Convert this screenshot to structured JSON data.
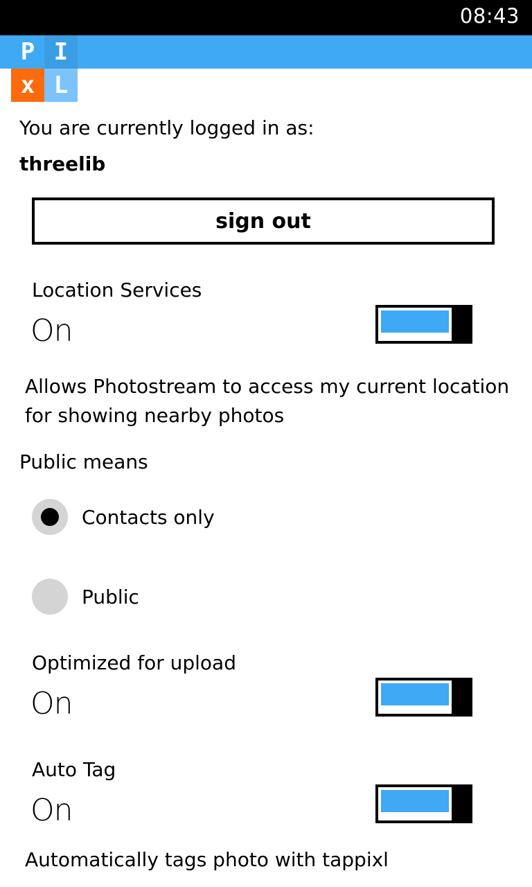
{
  "status_bar": {
    "time": "08:43"
  },
  "app": {
    "logo_letters": [
      "P",
      "I",
      "x",
      "L"
    ],
    "colors": {
      "accent": "#3fa9f5",
      "logo_orange": "#fb6a0c",
      "logo_light_blue": "#7cc3fb",
      "radio_gray": "#d4d4d4"
    }
  },
  "account": {
    "logged_in_label": "You are currently logged in as:",
    "username": "threelib",
    "sign_out_label": "sign out"
  },
  "location_services": {
    "label": "Location Services",
    "value": "On",
    "enabled": true,
    "description": "Allows Photostream to access my current location for showing nearby photos"
  },
  "public_means": {
    "label": "Public means",
    "options": [
      {
        "label": "Contacts only",
        "selected": true
      },
      {
        "label": "Public",
        "selected": false
      }
    ]
  },
  "optimized_upload": {
    "label": "Optimized for upload",
    "value": "On",
    "enabled": true
  },
  "auto_tag": {
    "label": "Auto Tag",
    "value": "On",
    "enabled": true,
    "description": "Automatically tags photo with tappixl"
  }
}
